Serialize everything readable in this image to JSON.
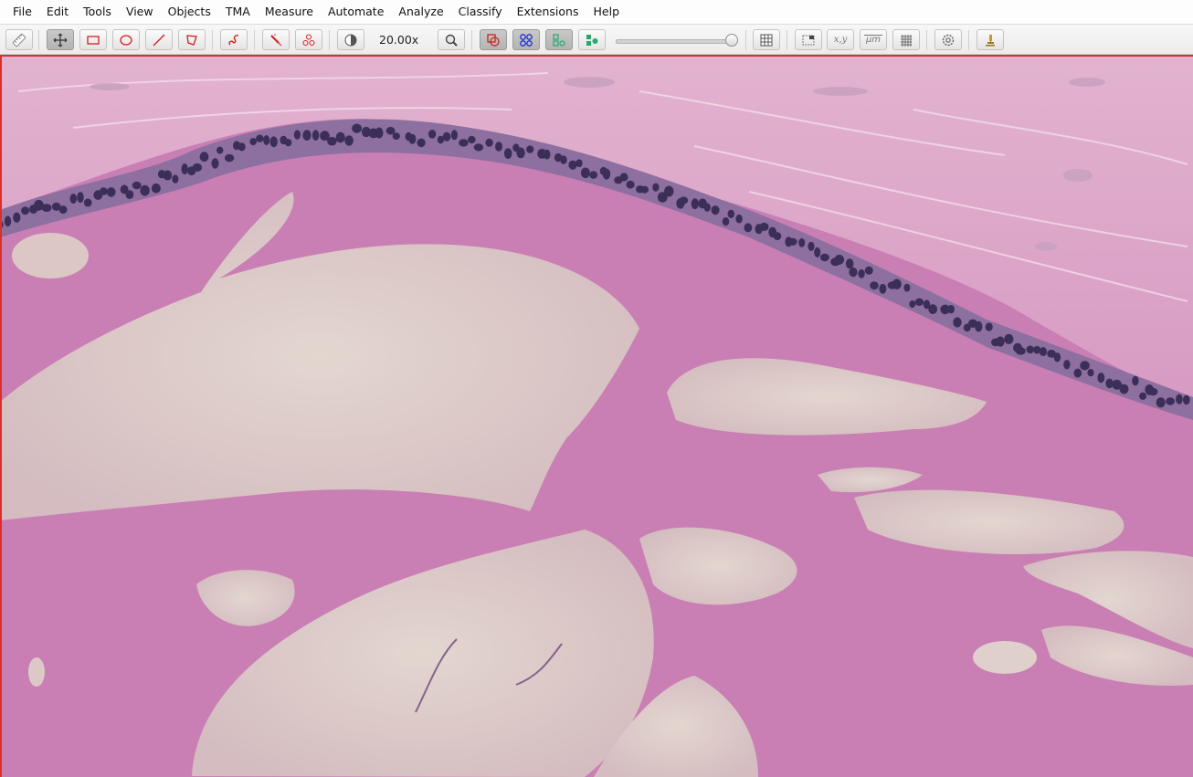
{
  "menu": {
    "items": [
      "File",
      "Edit",
      "Tools",
      "View",
      "Objects",
      "TMA",
      "Measure",
      "Automate",
      "Analyze",
      "Classify",
      "Extensions",
      "Help"
    ]
  },
  "toolbar": {
    "zoom_label": "20.00x",
    "tools": [
      {
        "name": "measure-tool-icon"
      },
      {
        "name": "move-tool-icon",
        "active": true
      },
      {
        "name": "rectangle-tool-icon"
      },
      {
        "name": "ellipse-tool-icon"
      },
      {
        "name": "line-tool-icon"
      },
      {
        "name": "polygon-tool-icon"
      },
      {
        "name": "brush-tool-icon"
      },
      {
        "name": "wand-tool-icon"
      },
      {
        "name": "points-tool-icon"
      },
      {
        "name": "contrast-icon"
      },
      {
        "name": "zoom-to-fit-icon"
      },
      {
        "name": "show-annotations-icon",
        "active": true
      },
      {
        "name": "show-tma-grid-icon",
        "active": true
      },
      {
        "name": "show-detections-icon",
        "active": true
      },
      {
        "name": "fill-detections-icon"
      },
      {
        "name": "table-icon"
      },
      {
        "name": "overview-icon"
      },
      {
        "name": "cursor-location-icon"
      },
      {
        "name": "scalebar-icon"
      },
      {
        "name": "grid-icon"
      },
      {
        "name": "settings-icon"
      },
      {
        "name": "microscope-icon"
      }
    ],
    "opacity_slider_value": 0.94,
    "coord_label": "x,y",
    "scale_label": "µm"
  },
  "viewer": {
    "accent": "#d9302c",
    "tissue_color": "#c97fb4",
    "stroma_color": "#e0a9c8",
    "space_color": "#dcc9c3",
    "nuclei_color": "#3c2f57"
  }
}
